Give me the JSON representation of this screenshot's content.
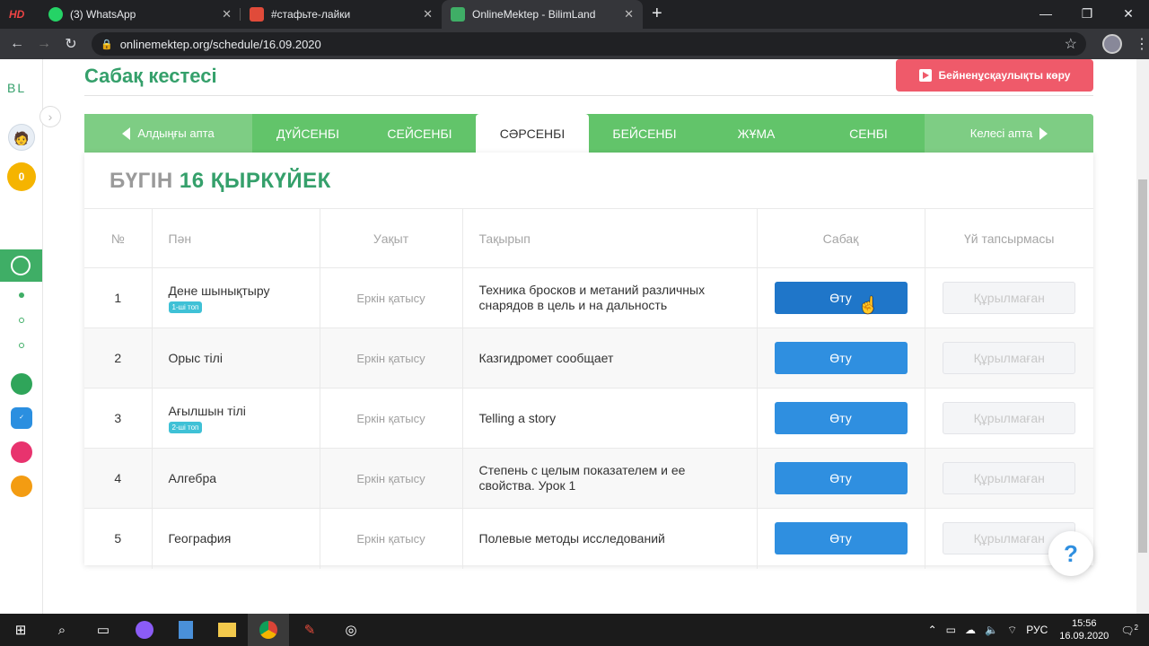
{
  "browser": {
    "tabs": [
      {
        "label": "(3) WhatsApp",
        "color": "#25d366"
      },
      {
        "label": "#стафьте-лайки",
        "color": "#e04b3a"
      },
      {
        "label": "OnlineMektep - BilimLand",
        "color": "#3fae66"
      }
    ],
    "url": "onlinemektep.org/schedule/16.09.2020",
    "hd_logo": "HD"
  },
  "sidebar": {
    "logo": "BL",
    "coins": "0"
  },
  "header": {
    "title": "Сабақ кестесі",
    "video_button": "Бейненұсқаулықты көру"
  },
  "week_nav": {
    "prev": "Алдыңғы апта",
    "next": "Келесі апта",
    "days": [
      "ДҮЙСЕНБІ",
      "СЕЙСЕНБІ",
      "СӘРСЕНБІ",
      "БЕЙСЕНБІ",
      "ЖҰМА",
      "СЕНБІ"
    ],
    "selected_index": 2
  },
  "today": {
    "prefix": "БҮГІН",
    "date": "16 ҚЫРКҮЙЕК"
  },
  "table": {
    "headers": [
      "№",
      "Пән",
      "Уақыт",
      "Тақырып",
      "Сабақ",
      "Үй тапсырмасы"
    ],
    "rows": [
      {
        "num": "1",
        "subject": "Дене шынықтыру",
        "badge": "1-ші топ",
        "time": "Еркін қатысу",
        "topic": "Техника бросков и метаний различных снарядов в цель и на дальность",
        "go": "Өту",
        "hw": "Құрылмаған"
      },
      {
        "num": "2",
        "subject": "Орыс тілі",
        "badge": "",
        "time": "Еркін қатысу",
        "topic": "Казгидромет сообщает",
        "go": "Өту",
        "hw": "Құрылмаған"
      },
      {
        "num": "3",
        "subject": "Ағылшын тілі",
        "badge": "2-ші топ",
        "time": "Еркін қатысу",
        "topic": "Telling a story",
        "go": "Өту",
        "hw": "Құрылмаған"
      },
      {
        "num": "4",
        "subject": "Алгебра",
        "badge": "",
        "time": "Еркін қатысу",
        "topic": "Степень с целым показателем и ее свойства. Урок 1",
        "go": "Өту",
        "hw": "Құрылмаған"
      },
      {
        "num": "5",
        "subject": "География",
        "badge": "",
        "time": "Еркін қатысу",
        "topic": "Полевые методы исследований",
        "go": "Өту",
        "hw": "Құрылмаған"
      }
    ]
  },
  "help": "?",
  "taskbar": {
    "lang": "РУС",
    "time": "15:56",
    "date": "16.09.2020",
    "notifications": "2"
  }
}
